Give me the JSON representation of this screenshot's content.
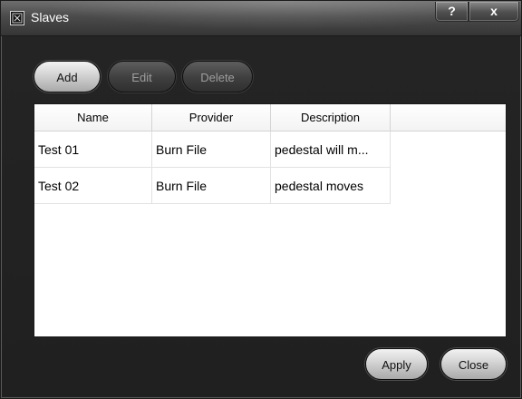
{
  "window": {
    "title": "Slaves",
    "help_label": "?",
    "close_label": "x"
  },
  "toolbar": {
    "add_label": "Add",
    "edit_label": "Edit",
    "delete_label": "Delete"
  },
  "table": {
    "columns": [
      "Name",
      "Provider",
      "Description"
    ],
    "rows": [
      {
        "name": "Test 01",
        "provider": "Burn File",
        "description": "pedestal will m..."
      },
      {
        "name": "Test 02",
        "provider": "Burn File",
        "description": "pedestal moves"
      }
    ]
  },
  "footer": {
    "apply_label": "Apply",
    "close_label": "Close"
  },
  "colors": {
    "window_bg": "#242424",
    "titlebar": "#4b4b4b",
    "active_button": "#cfcfcf",
    "disabled_button": "#3e3e3e"
  }
}
